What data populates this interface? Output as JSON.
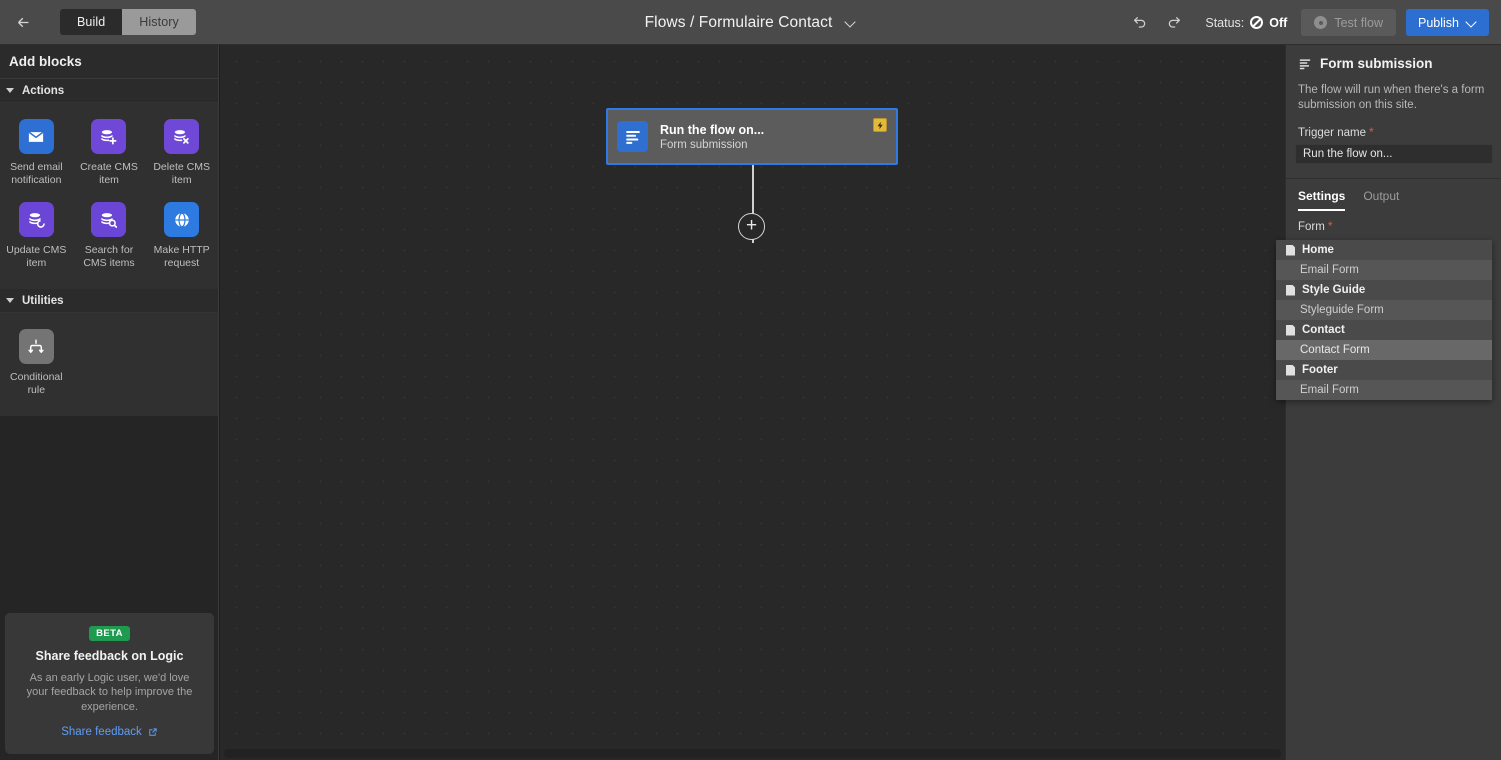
{
  "topbar": {
    "back_icon": "arrow-left-icon",
    "tabs": [
      {
        "label": "Build",
        "active": true
      },
      {
        "label": "History",
        "active": false
      }
    ],
    "flow_title": "Flows / Formulaire Contact",
    "undo_icon": "undo-icon",
    "redo_icon": "redo-icon",
    "status_label": "Status:",
    "status_value": "Off",
    "test_flow_label": "Test flow",
    "publish_label": "Publish"
  },
  "sidebar": {
    "header": "Add blocks",
    "sections": [
      {
        "title": "Actions",
        "blocks": [
          {
            "label": "Send email notification",
            "icon": "envelope-icon",
            "color": "#2d6fd2"
          },
          {
            "label": "Create CMS item",
            "icon": "cms-plus-icon",
            "color": "#7048d8"
          },
          {
            "label": "Delete CMS item",
            "icon": "cms-x-icon",
            "color": "#7048d8"
          },
          {
            "label": "Update CMS item",
            "icon": "cms-refresh-icon",
            "color": "#6a45d6"
          },
          {
            "label": "Search for CMS items",
            "icon": "cms-search-icon",
            "color": "#6a45d6"
          },
          {
            "label": "Make HTTP request",
            "icon": "globe-icon",
            "color": "#2d7ae0"
          }
        ]
      },
      {
        "title": "Utilities",
        "blocks": [
          {
            "label": "Conditional rule",
            "icon": "branch-icon",
            "color": "#747474"
          }
        ]
      }
    ],
    "feedback": {
      "badge": "BETA",
      "title": "Share feedback on Logic",
      "body": "As an early Logic user, we'd love your feedback to help improve the experience.",
      "link": "Share feedback",
      "link_icon": "external-link-icon"
    }
  },
  "canvas": {
    "node": {
      "title": "Run the flow on...",
      "subtitle": "Form submission",
      "icon": "form-submission-icon",
      "badge_icon": "lightning-icon"
    },
    "add_node_icon": "plus-icon"
  },
  "right_panel": {
    "header_icon": "form-submission-icon",
    "title": "Form submission",
    "description": "The flow will run when there's a form submission on this site.",
    "trigger_name_label": "Trigger name",
    "trigger_name_required": "*",
    "trigger_name_value": "Run the flow on...",
    "tabs": [
      {
        "label": "Settings",
        "active": true
      },
      {
        "label": "Output",
        "active": false
      }
    ],
    "form_label": "Form",
    "form_required": "*",
    "form_options": [
      {
        "label": "Home",
        "type": "group",
        "selected": false
      },
      {
        "label": "Email Form",
        "type": "item",
        "selected": false
      },
      {
        "label": "Style Guide",
        "type": "group",
        "selected": false
      },
      {
        "label": "Styleguide Form",
        "type": "item",
        "selected": false
      },
      {
        "label": "Contact",
        "type": "group",
        "selected": false
      },
      {
        "label": "Contact Form",
        "type": "item",
        "selected": true
      },
      {
        "label": "Footer",
        "type": "group",
        "selected": false
      },
      {
        "label": "Email Form",
        "type": "item",
        "selected": false
      }
    ]
  },
  "colors": {
    "accent": "#2c6fd1",
    "selection": "#2f7ae5",
    "beta": "#1f9b4f",
    "required": "#e2574c",
    "badge": "#e3b93c"
  }
}
